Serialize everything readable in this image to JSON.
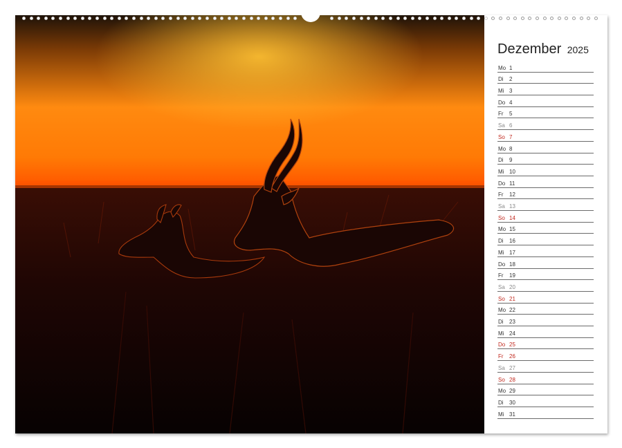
{
  "calendar": {
    "month": "Dezember",
    "year": "2025",
    "days": [
      {
        "wd": "Mo",
        "d": "1",
        "type": "normal"
      },
      {
        "wd": "Di",
        "d": "2",
        "type": "normal"
      },
      {
        "wd": "Mi",
        "d": "3",
        "type": "normal"
      },
      {
        "wd": "Do",
        "d": "4",
        "type": "normal"
      },
      {
        "wd": "Fr",
        "d": "5",
        "type": "normal"
      },
      {
        "wd": "Sa",
        "d": "6",
        "type": "sat"
      },
      {
        "wd": "So",
        "d": "7",
        "type": "sun"
      },
      {
        "wd": "Mo",
        "d": "8",
        "type": "normal"
      },
      {
        "wd": "Di",
        "d": "9",
        "type": "normal"
      },
      {
        "wd": "Mi",
        "d": "10",
        "type": "normal"
      },
      {
        "wd": "Do",
        "d": "11",
        "type": "normal"
      },
      {
        "wd": "Fr",
        "d": "12",
        "type": "normal"
      },
      {
        "wd": "Sa",
        "d": "13",
        "type": "sat"
      },
      {
        "wd": "So",
        "d": "14",
        "type": "sun"
      },
      {
        "wd": "Mo",
        "d": "15",
        "type": "normal"
      },
      {
        "wd": "Di",
        "d": "16",
        "type": "normal"
      },
      {
        "wd": "Mi",
        "d": "17",
        "type": "normal"
      },
      {
        "wd": "Do",
        "d": "18",
        "type": "normal"
      },
      {
        "wd": "Fr",
        "d": "19",
        "type": "normal"
      },
      {
        "wd": "Sa",
        "d": "20",
        "type": "sat"
      },
      {
        "wd": "So",
        "d": "21",
        "type": "sun"
      },
      {
        "wd": "Mo",
        "d": "22",
        "type": "normal"
      },
      {
        "wd": "Di",
        "d": "23",
        "type": "normal"
      },
      {
        "wd": "Mi",
        "d": "24",
        "type": "normal"
      },
      {
        "wd": "Do",
        "d": "25",
        "type": "sun"
      },
      {
        "wd": "Fr",
        "d": "26",
        "type": "sun"
      },
      {
        "wd": "Sa",
        "d": "27",
        "type": "sat"
      },
      {
        "wd": "So",
        "d": "28",
        "type": "sun"
      },
      {
        "wd": "Mo",
        "d": "29",
        "type": "normal"
      },
      {
        "wd": "Di",
        "d": "30",
        "type": "normal"
      },
      {
        "wd": "Mi",
        "d": "31",
        "type": "normal"
      }
    ]
  },
  "photo": {
    "icon": "antelope-sunset-silhouette",
    "colors": {
      "sky_top": "#1a0d06",
      "sky_glow": "#ff9a1a",
      "horizon": "#ff6a00",
      "ground": "#2a0905",
      "accent_red": "#c0271c"
    }
  }
}
